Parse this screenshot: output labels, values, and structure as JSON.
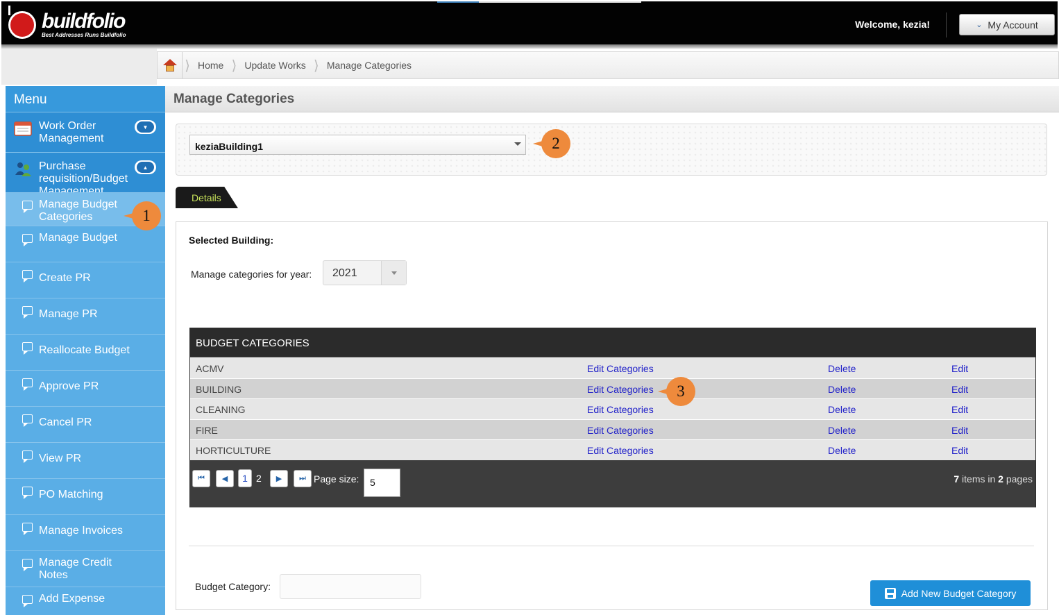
{
  "app": {
    "logo_text": "buildfolio",
    "logo_tagline": "Best Addresses Runs Buildfolio",
    "welcome": "Welcome, kezia!",
    "account_button": "My Account"
  },
  "breadcrumb": {
    "items": [
      "Home",
      "Update Works",
      "Manage Categories"
    ]
  },
  "menu": {
    "title": "Menu",
    "groups": [
      {
        "label": "Work Order Management",
        "icon": "calendar-icon",
        "expanded": false
      },
      {
        "label": "Purchase requisition/Budget Management",
        "icon": "users-icon",
        "expanded": true
      }
    ],
    "items": [
      {
        "label": "Manage Budget Categories",
        "active": true
      },
      {
        "label": "Manage Budget"
      },
      {
        "label": "Create PR"
      },
      {
        "label": "Manage PR"
      },
      {
        "label": "Reallocate Budget"
      },
      {
        "label": "Approve PR"
      },
      {
        "label": "Cancel PR"
      },
      {
        "label": "View PR"
      },
      {
        "label": "PO Matching"
      },
      {
        "label": "Manage Invoices"
      },
      {
        "label": "Manage Credit Notes"
      },
      {
        "label": "Add Expense"
      }
    ]
  },
  "page": {
    "title": "Manage Categories",
    "building_select": "keziaBuilding1",
    "tab_label": "Details",
    "selected_building_label": "Selected Building:",
    "year_label": "Manage categories for year:",
    "year_value": "2021"
  },
  "grid": {
    "header": "BUDGET CATEGORIES",
    "rows": [
      {
        "name": "ACMV",
        "edit_categories": "Edit Categories",
        "delete": "Delete",
        "edit": "Edit"
      },
      {
        "name": "BUILDING",
        "edit_categories": "Edit Categories",
        "delete": "Delete",
        "edit": "Edit"
      },
      {
        "name": "CLEANING",
        "edit_categories": "Edit Categories",
        "delete": "Delete",
        "edit": "Edit"
      },
      {
        "name": "FIRE",
        "edit_categories": "Edit Categories",
        "delete": "Delete",
        "edit": "Edit"
      },
      {
        "name": "HORTICULTURE",
        "edit_categories": "Edit Categories",
        "delete": "Delete",
        "edit": "Edit"
      }
    ],
    "pager": {
      "current_page": "1",
      "other_page": "2",
      "page_size_label": "Page size:",
      "page_size": "5",
      "items_count": "7",
      "items_text": "items in",
      "pages_count": "2",
      "pages_text": "pages"
    }
  },
  "form": {
    "budget_category_label": "Budget Category:",
    "budget_category_value": "",
    "add_button": "Add New Budget Category"
  },
  "callouts": [
    "1",
    "2",
    "3"
  ],
  "colors": {
    "accent_blue": "#2e8ed4",
    "menu_blue": "#5aaee6",
    "callout_orange": "#ee8a3c",
    "link_blue": "#2323c9",
    "tab_green": "#c8e35a"
  }
}
